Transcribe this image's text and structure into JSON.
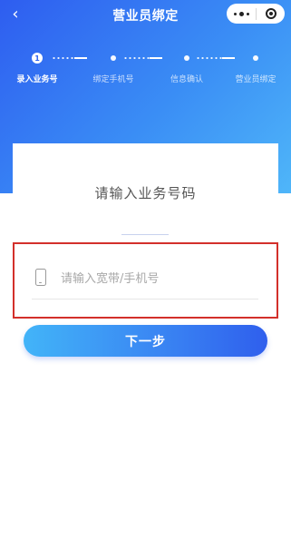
{
  "nav": {
    "title": "营业员绑定",
    "back_icon": "chevron-left-icon",
    "capsule_more_icon": "more-dots-icon",
    "capsule_close_icon": "target-circle-icon"
  },
  "steps": [
    {
      "number": "1",
      "label": "录入业务号",
      "active": true
    },
    {
      "number": "",
      "label": "绑定手机号",
      "active": false
    },
    {
      "number": "",
      "label": "信息确认",
      "active": false
    },
    {
      "number": "",
      "label": "营业员绑定",
      "active": false
    }
  ],
  "card": {
    "title": "请输入业务号码"
  },
  "input": {
    "icon": "phone-icon",
    "placeholder": "请输入宽带/手机号",
    "value": ""
  },
  "next_button": {
    "label": "下一步"
  },
  "colors": {
    "header_gradient_start": "#2e5df0",
    "header_gradient_end": "#4fb6f9",
    "highlight_border": "#d3302b",
    "button_gradient_start": "#42b4f8",
    "button_gradient_end": "#2f5fed"
  }
}
